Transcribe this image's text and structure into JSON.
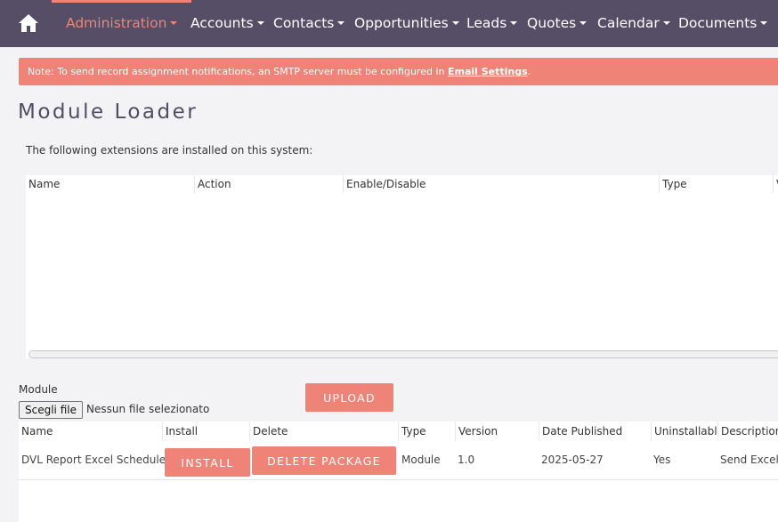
{
  "nav": {
    "items": [
      {
        "label": "Administration",
        "active": true
      },
      {
        "label": "Accounts"
      },
      {
        "label": "Contacts"
      },
      {
        "label": "Opportunities"
      },
      {
        "label": "Leads"
      },
      {
        "label": "Quotes"
      },
      {
        "label": "Calendar"
      },
      {
        "label": "Documents"
      }
    ],
    "home_icon": "home-icon",
    "dropdown_icon": "caret-down-icon",
    "bar_color": "#554e66",
    "accent_color": "#f08377"
  },
  "notice": {
    "text": "Note: To send record assignment notifications, an SMTP server must be configured in ",
    "link": "Email Settings",
    "suffix": "."
  },
  "page": {
    "title": "Module Loader",
    "intro": "The following extensions are installed on this system:"
  },
  "extensions_table": {
    "headers": [
      "Name",
      "Action",
      "Enable/Disable",
      "Type",
      "V"
    ],
    "rows": []
  },
  "upload": {
    "module_label": "Module",
    "file_button": "Scegli file",
    "no_file_text": "Nessun file selezionato",
    "upload_button": "UPLOAD"
  },
  "packages_table": {
    "headers": [
      "Name",
      "Install",
      "Delete",
      "Type",
      "Version",
      "Date Published",
      "Uninstallable",
      "Description"
    ],
    "rows": [
      {
        "name": "DVL Report Excel Scheduler",
        "install": "INSTALL",
        "delete": "DELETE PACKAGE",
        "type": "Module",
        "version": "1.0",
        "date_published": "2025-05-27",
        "uninstallable": "Yes",
        "description": "Send Excel"
      }
    ]
  }
}
